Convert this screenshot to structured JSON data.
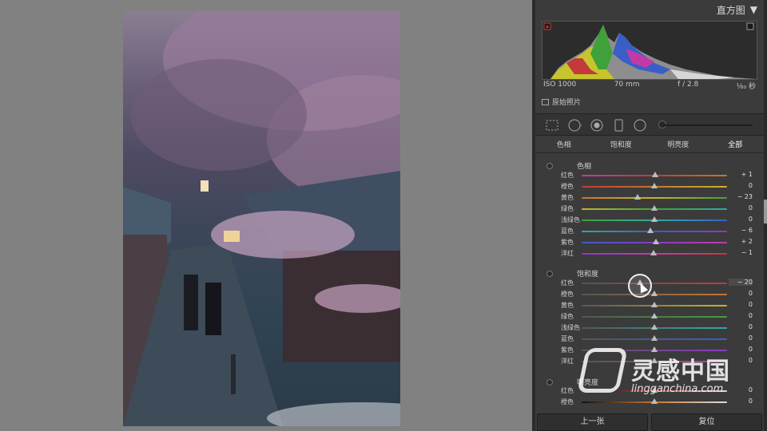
{
  "histogram": {
    "title": "直方图",
    "menu_glyph": "▼",
    "iso": "ISO 1000",
    "focal": "70 mm",
    "aperture": "f / 2.8",
    "shutter": "¹⁄₈₀ 秒",
    "original_photo_label": "原始照片"
  },
  "tools": [
    "crop-overlay-icon",
    "spot-removal-icon",
    "red-eye-icon",
    "graduated-filter-icon",
    "radial-filter-icon",
    "adjustment-brush-icon"
  ],
  "tabs": {
    "hue": "色相",
    "saturation": "饱和度",
    "luminance": "明亮度",
    "all": "全部",
    "active": "全部"
  },
  "hue_section": {
    "title": "色相",
    "rows": [
      {
        "label": "红色",
        "value": "+ 1",
        "amount": 1
      },
      {
        "label": "橙色",
        "value": "0",
        "amount": 0
      },
      {
        "label": "黄色",
        "value": "− 23",
        "amount": -23
      },
      {
        "label": "绿色",
        "value": "0",
        "amount": 0
      },
      {
        "label": "浅绿色",
        "value": "0",
        "amount": 0
      },
      {
        "label": "蓝色",
        "value": "− 6",
        "amount": -6
      },
      {
        "label": "紫色",
        "value": "+ 2",
        "amount": 2
      },
      {
        "label": "洋红",
        "value": "− 1",
        "amount": -1
      }
    ]
  },
  "saturation_section": {
    "title": "饱和度",
    "rows": [
      {
        "label": "红色",
        "value": "− 20",
        "amount": -20
      },
      {
        "label": "橙色",
        "value": "0",
        "amount": 0
      },
      {
        "label": "黄色",
        "value": "0",
        "amount": 0
      },
      {
        "label": "绿色",
        "value": "0",
        "amount": 0
      },
      {
        "label": "浅绿色",
        "value": "0",
        "amount": 0
      },
      {
        "label": "蓝色",
        "value": "0",
        "amount": 0
      },
      {
        "label": "紫色",
        "value": "0",
        "amount": 0
      },
      {
        "label": "洋红",
        "value": "0",
        "amount": 0
      }
    ]
  },
  "luminance_section": {
    "title": "明亮度",
    "rows": [
      {
        "label": "红色",
        "value": "0",
        "amount": 0
      },
      {
        "label": "橙色",
        "value": "0",
        "amount": 0
      }
    ]
  },
  "buttons": {
    "previous": "上一张",
    "reset": "复位"
  },
  "watermark": {
    "cn": "灵感中国",
    "en": "lingganchina.com"
  },
  "colors": {
    "red": "#c23a3a",
    "orange": "#c7762d",
    "yellow": "#c7b52d",
    "green": "#3fa13a",
    "aqua": "#2faaa6",
    "blue": "#3a5ec7",
    "purple": "#8a3ac7",
    "magenta": "#c23aa6"
  }
}
